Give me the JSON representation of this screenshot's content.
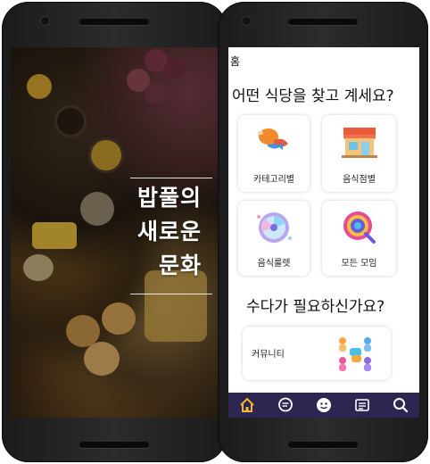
{
  "splash": {
    "line1": "밥풀의",
    "line2": "새로운",
    "line3": "문화"
  },
  "app": {
    "header_title": "홈",
    "question_restaurant": "어떤 식당을 찾고 계세요?",
    "cards": [
      {
        "label": "카테고리별",
        "icon": "food-category-icon"
      },
      {
        "label": "음식점별",
        "icon": "storefront-icon"
      },
      {
        "label": "음식룰렛",
        "icon": "roulette-icon"
      },
      {
        "label": "모든 모임",
        "icon": "all-meetings-icon"
      }
    ],
    "question_chat": "수다가 필요하신가요?",
    "community_label": "커뮤니티",
    "nav": [
      "home-icon",
      "chat-icon",
      "emoji-icon",
      "list-icon",
      "search-icon"
    ],
    "colors": {
      "nav_bg": "#2c2650",
      "nav_active": "#f5b82e",
      "nav_icon": "#ffffff"
    }
  }
}
